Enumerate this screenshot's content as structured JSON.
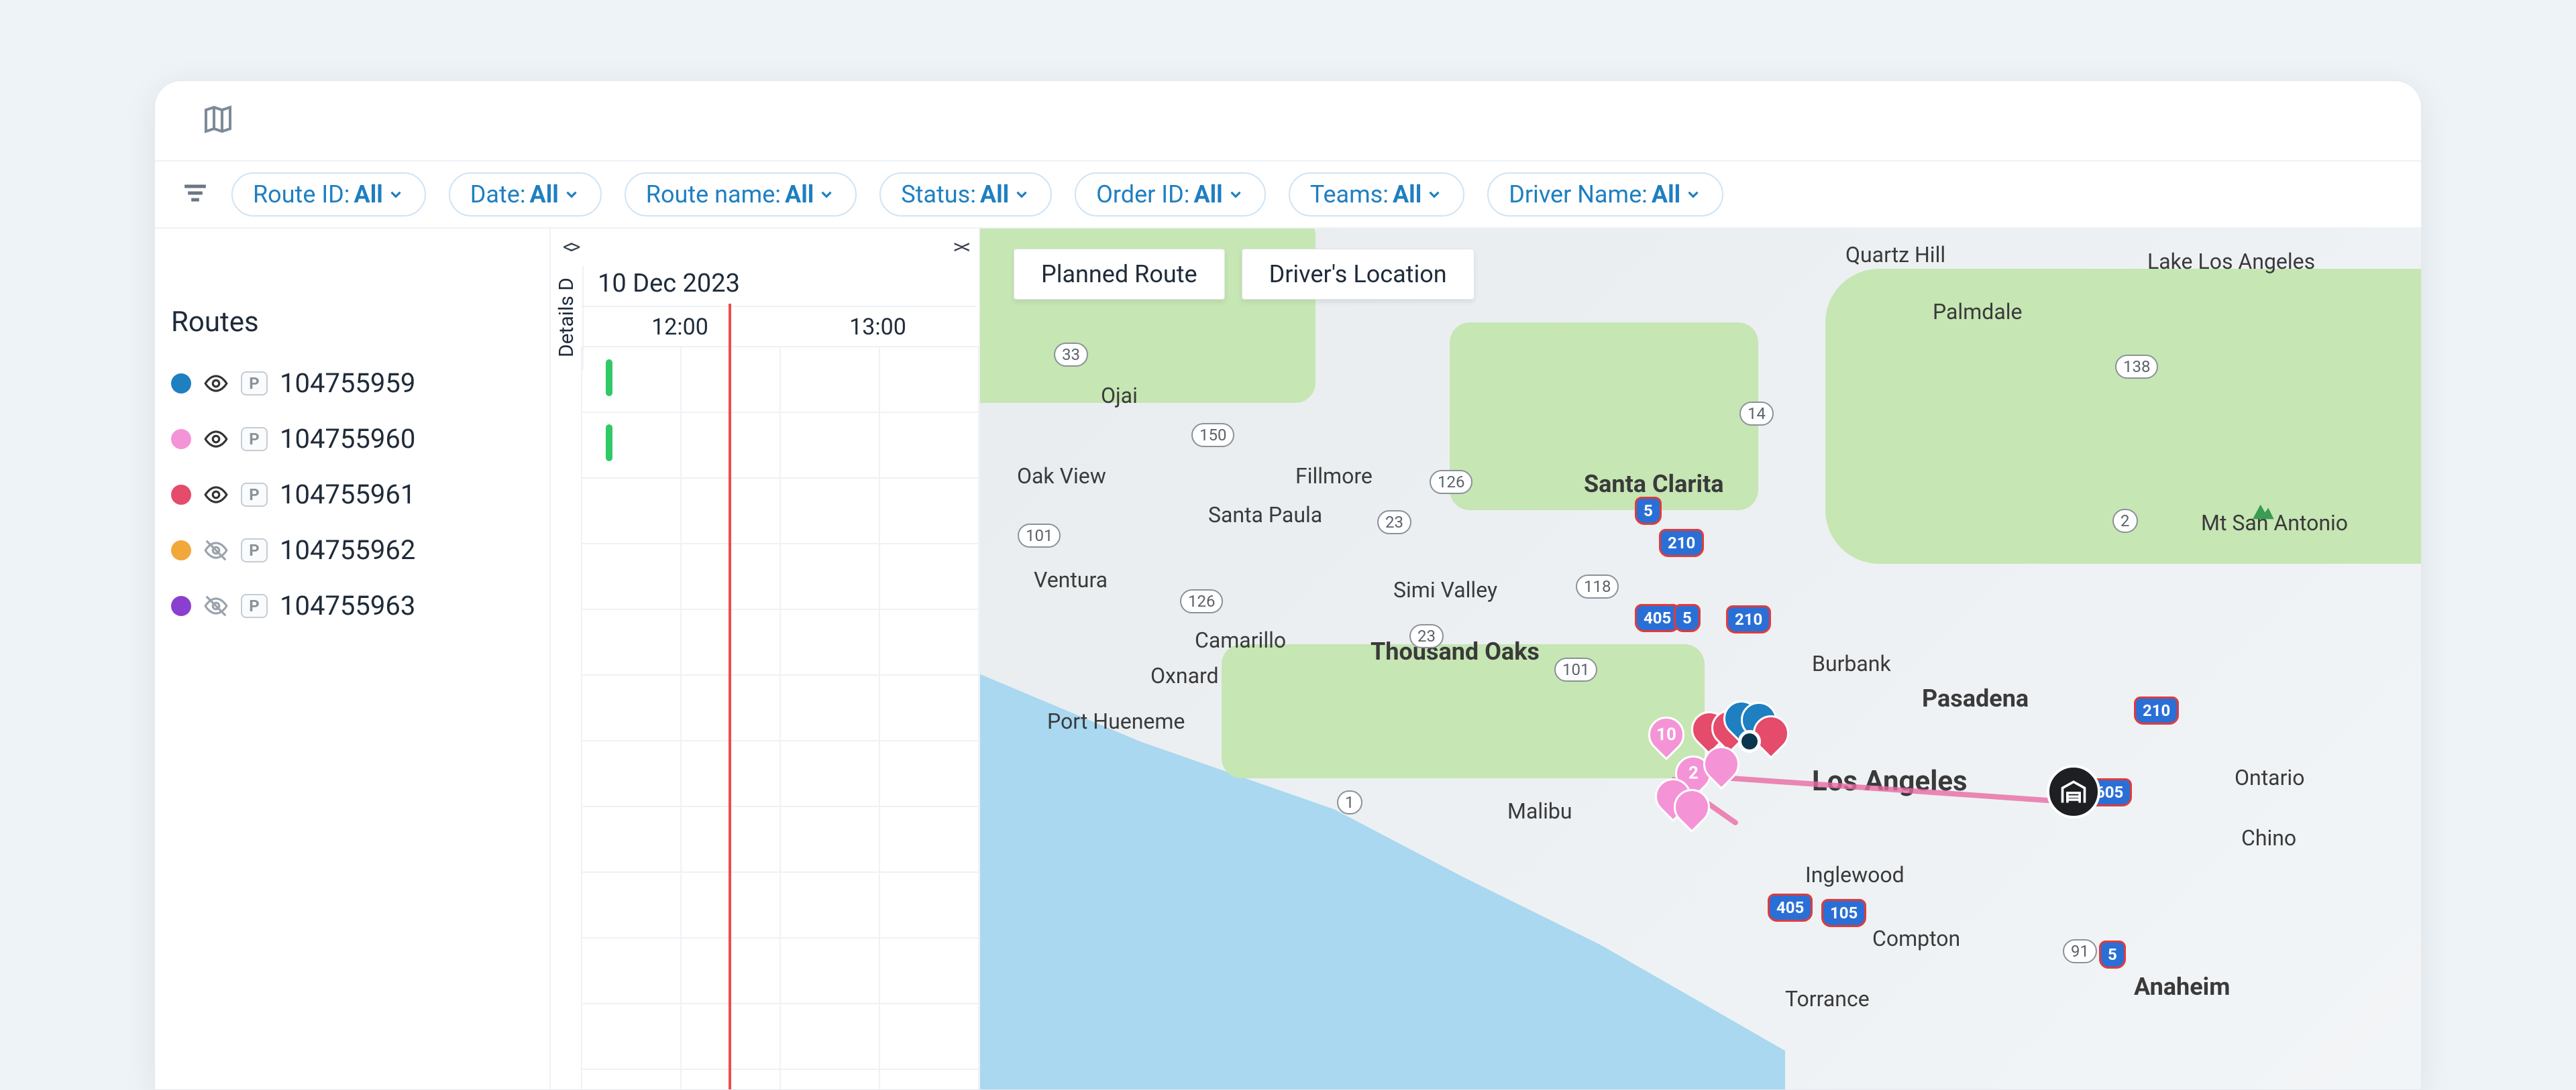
{
  "filters": [
    {
      "label": "Route ID:",
      "value": "All"
    },
    {
      "label": "Date:",
      "value": "All"
    },
    {
      "label": "Route name:",
      "value": "All"
    },
    {
      "label": "Status:",
      "value": "All"
    },
    {
      "label": "Order ID:",
      "value": "All"
    },
    {
      "label": "Teams:",
      "value": "All"
    },
    {
      "label": "Driver Name:",
      "value": "All"
    }
  ],
  "routes_header": "Routes",
  "routes": [
    {
      "id": "104755959",
      "color": "#1e7fc1",
      "visible": true
    },
    {
      "id": "104755960",
      "color": "#f494d6",
      "visible": true
    },
    {
      "id": "104755961",
      "color": "#e54b6a",
      "visible": true
    },
    {
      "id": "104755962",
      "color": "#f2a73b",
      "visible": false
    },
    {
      "id": "104755963",
      "color": "#8a3fd1",
      "visible": false
    }
  ],
  "p_badge_label": "P",
  "timeline": {
    "date": "10 Dec 2023",
    "details_label": "Details   D",
    "hours": [
      "12:00",
      "13:00"
    ]
  },
  "map_buttons": [
    "Planned Route",
    "Driver's Location"
  ],
  "map_labels": {
    "quartz": "Quartz Hill",
    "lakela": "Lake Los Angeles",
    "palmdale": "Palmdale",
    "ojai": "Ojai",
    "oakview": "Oak View",
    "fillmore": "Fillmore",
    "santaclarita": "Santa Clarita",
    "santapaula": "Santa Paula",
    "mtsanantonio": "Mt San Antonio",
    "simi": "Simi Valley",
    "ventura": "Ventura",
    "camarillo": "Camarillo",
    "thousandoaks": "Thousand Oaks",
    "burbank": "Burbank",
    "pasadena": "Pasadena",
    "oxnard": "Oxnard",
    "porthueneme": "Port Hueneme",
    "losangeles": "Los Angeles",
    "malibu": "Malibu",
    "ontario": "Ontario",
    "chino": "Chino",
    "inglewood": "Inglewood",
    "compton": "Compton",
    "torrance": "Torrance",
    "anaheim": "Anaheim"
  },
  "map_routes": {
    "r33": "33",
    "r150": "150",
    "r126": "126",
    "r101": "101",
    "r23": "23",
    "r118": "118",
    "r1": "1",
    "r2": "2",
    "r91": "91",
    "r14": "14",
    "r138": "138"
  },
  "map_interstates": {
    "i5": "5",
    "i210": "210",
    "i405": "405",
    "i105": "105",
    "i605": "605"
  },
  "pin_10": "10",
  "pin_2": "2"
}
